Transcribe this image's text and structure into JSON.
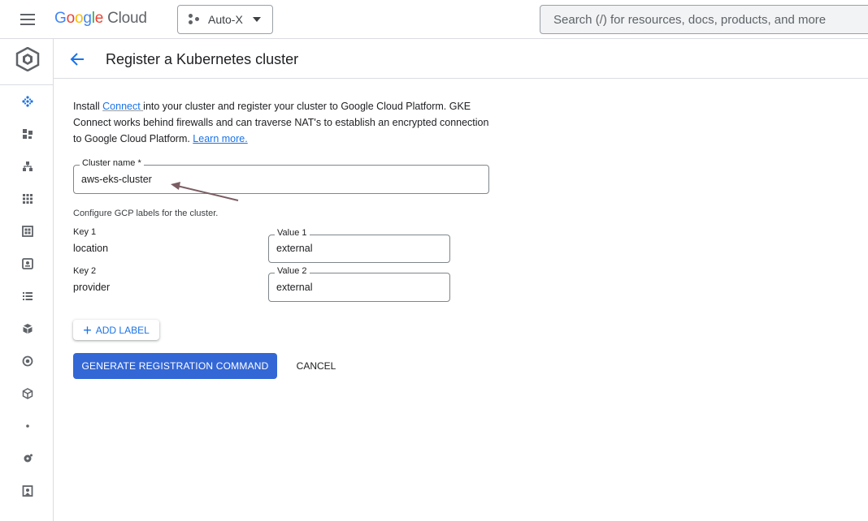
{
  "topbar": {
    "logo_text": "Google",
    "logo_suffix": "Cloud",
    "project_name": "Auto-X",
    "search_placeholder": "Search (/) for resources, docs, products, and more"
  },
  "sidebar": {
    "items": [
      {
        "icon": "fleet-dots-icon",
        "active": true
      },
      {
        "icon": "workloads-icon"
      },
      {
        "icon": "hierarchy-icon"
      },
      {
        "icon": "grid-icon"
      },
      {
        "icon": "dashboard-icon"
      },
      {
        "icon": "monitor-icon"
      },
      {
        "icon": "list-icon"
      },
      {
        "icon": "packages-icon"
      },
      {
        "icon": "target-icon"
      },
      {
        "icon": "cube-icon"
      },
      {
        "icon": "dot-icon"
      },
      {
        "icon": "settings-icon"
      },
      {
        "icon": "badge-icon"
      }
    ]
  },
  "header": {
    "title": "Register a Kubernetes cluster"
  },
  "intro": {
    "part1": "Install ",
    "link": "Connect ",
    "part2": "into your cluster and register your cluster to Google Cloud Platform. GKE Connect works behind firewalls and can traverse NAT's to establish an encrypted connection to Google Cloud Platform. ",
    "learn_more": "Learn more."
  },
  "form": {
    "cluster_name_label": "Cluster name *",
    "cluster_name_value": "aws-eks-cluster",
    "labels_hint": "Configure GCP labels for the cluster.",
    "labels": [
      {
        "key_label": "Key 1",
        "key_value": "location",
        "value_label": "Value 1",
        "value_value": "external"
      },
      {
        "key_label": "Key 2",
        "key_value": "provider",
        "value_label": "Value 2",
        "value_value": "external"
      }
    ],
    "add_label": "ADD LABEL",
    "generate_button": "GENERATE REGISTRATION COMMAND",
    "cancel_button": "CANCEL"
  },
  "colors": {
    "accent": "#1a73e8",
    "primary_button": "#3367d6",
    "annotation_arrow": "#7b5d63"
  }
}
